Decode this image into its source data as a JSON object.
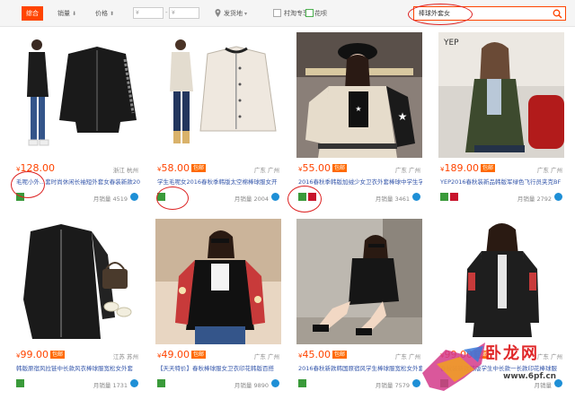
{
  "filters": {
    "tab_all": "综合",
    "sort_sales": "销量",
    "sort_price": "价格",
    "price_min": "¥",
    "price_max": "¥",
    "ship_from": "发货地",
    "option_cun": "村淘专享",
    "option_huabei": "花呗"
  },
  "search": {
    "value": "棒球外套女"
  },
  "products": [
    {
      "price": "128.00",
      "badge": "",
      "location": "浙江 杭州",
      "title_pre": "毛呢小外",
      "title_mid": "...",
      "title_hi": "外套女",
      "title_post": "春装新款2016",
      "title": "毛呢小外...套时尚休闲长袖短外套女春装新款2016",
      "sales": "月销量 4519",
      "icon_colors": [
        "#3a9a3a"
      ]
    },
    {
      "price": "58.00",
      "badge": "包邮",
      "location": "广东 广州",
      "title": "学生毛呢女2016春秋季韩版太空棉棒球服女开",
      "sales": "月销量 2004",
      "icon_colors": [
        "#3a9a3a"
      ]
    },
    {
      "price": "55.00",
      "badge": "包邮",
      "location": "广东 广州",
      "title": "2016春秋季韩版加绒少女卫衣外套棒球中学生学",
      "sales": "月销量 3461",
      "icon_colors": [
        "#3a9a3a",
        "#c8142b"
      ]
    },
    {
      "price": "189.00",
      "badge": "包邮",
      "location": "广东 广州",
      "title": "YEP2016春秋装新品韩版军绿色飞行员夹克BF",
      "sales": "月销量 2792",
      "icon_colors": [
        "#3a9a3a",
        "#c8142b"
      ]
    },
    {
      "price": "99.00",
      "badge": "包邮",
      "location": "江苏 苏州",
      "title": "韩版原宿风拉链中长款风衣棒球服宽松女外套",
      "sales": "月销量 1731",
      "icon_colors": [
        "#3a9a3a"
      ]
    },
    {
      "price": "49.00",
      "badge": "包邮",
      "location": "广东 广州",
      "title": "【天天特价】春秋棒球服女卫衣印花韩版百搭",
      "sales": "月销量 9890",
      "icon_colors": [
        "#3a9a3a"
      ]
    },
    {
      "price": "45.00",
      "badge": "包邮",
      "location": "广东 广州",
      "title": "2016春秋新款韩国原宿风学生棒球服宽松女外套",
      "sales": "月销量 7579",
      "icon_colors": [
        "#3a9a3a"
      ]
    },
    {
      "price": "99.00",
      "badge": "包邮",
      "location": "广东 广州",
      "title": "春秋装新款韩版学生中长款一长款印花棒球服",
      "sales": "月销量",
      "icon_colors": [
        "#3a9a3a"
      ]
    }
  ],
  "watermark": {
    "text": "卧龙网",
    "url": "www.6pf.cn"
  },
  "colors": {
    "accent": "#ff4400",
    "link": "#3355aa",
    "highlight": "#e4393c",
    "annotation": "#dd2222"
  }
}
